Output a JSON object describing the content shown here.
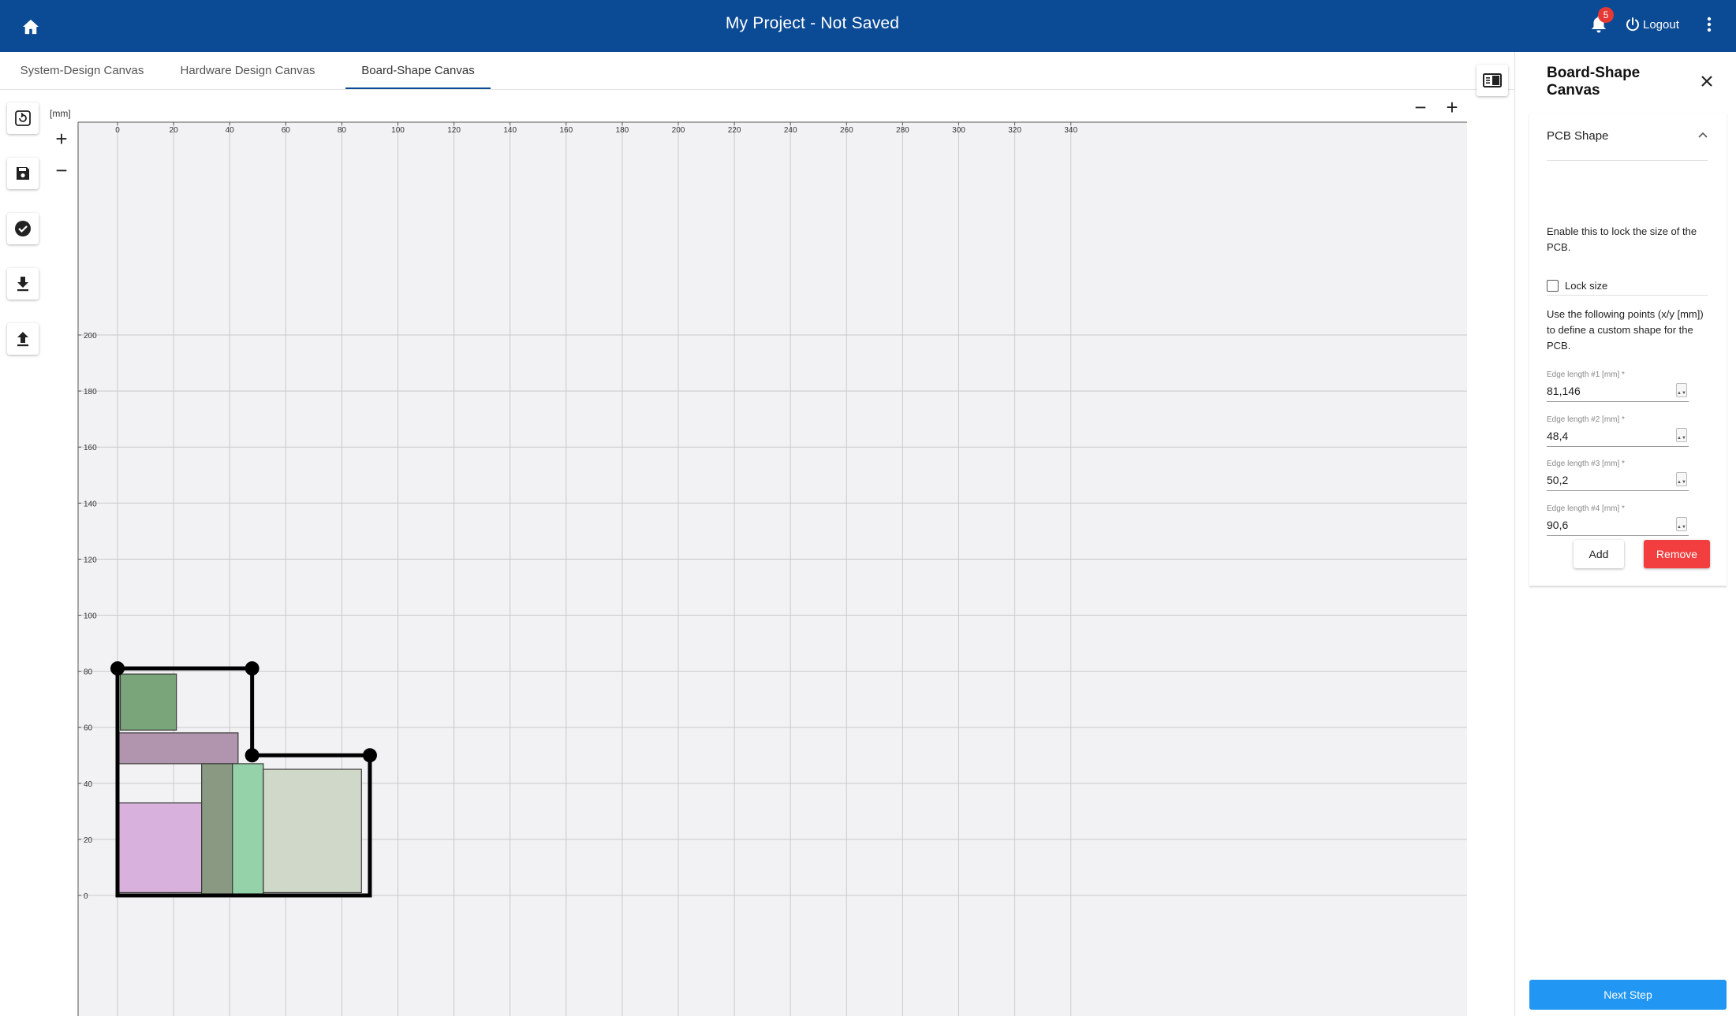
{
  "header": {
    "title": "My Project - Not Saved",
    "notification_count": "5",
    "logout_label": "Logout",
    "colors": {
      "bar": "#0b4a94",
      "badge": "#e53935"
    },
    "icons": {
      "home": "home-icon",
      "bell": "bell-icon",
      "power": "power-icon",
      "menu": "more-vert-icon"
    }
  },
  "tabs": [
    {
      "label": "System-Design Canvas",
      "active": false
    },
    {
      "label": "Hardware Design Canvas",
      "active": false
    },
    {
      "label": "Board-Shape Canvas",
      "active": true
    }
  ],
  "toolbar": {
    "icons": [
      "reset-icon",
      "save-icon",
      "check-circle-icon",
      "download-icon",
      "upload-icon"
    ],
    "zoom_in": "+",
    "zoom_out": "−"
  },
  "canvas": {
    "unit_label": "[mm]",
    "x_ticks": [
      0,
      20,
      40,
      60,
      80,
      100,
      120,
      140,
      160,
      180,
      200,
      220,
      240,
      260,
      280,
      300,
      320,
      340
    ],
    "y_ticks": [
      0,
      20,
      40,
      60,
      80,
      100,
      120,
      140,
      160,
      180,
      200
    ],
    "x_range": [
      0,
      340
    ],
    "y_range": [
      0,
      200
    ],
    "pcb_outline": [
      [
        0,
        81
      ],
      [
        48,
        81
      ],
      [
        48,
        50
      ],
      [
        90,
        50
      ],
      [
        90,
        0
      ],
      [
        0,
        0
      ]
    ],
    "components": [
      {
        "x0": 1,
        "y0": 59,
        "x1": 21,
        "y1": 79,
        "color": "#7aa57a"
      },
      {
        "x0": 0,
        "y0": 47,
        "x1": 43,
        "y1": 58,
        "color": "#b195af"
      },
      {
        "x0": 0,
        "y0": 1,
        "x1": 30,
        "y1": 33,
        "color": "#d8b1dd"
      },
      {
        "x0": 30,
        "y0": 0,
        "x1": 41,
        "y1": 47,
        "color": "#8a9a82"
      },
      {
        "x0": 41,
        "y0": 0,
        "x1": 52,
        "y1": 47,
        "color": "#95d2aa"
      },
      {
        "x0": 52,
        "y0": 1,
        "x1": 87,
        "y1": 45,
        "color": "#d0d8c9"
      }
    ]
  },
  "panel": {
    "title": "Board-Shape Canvas",
    "section": "PCB Shape",
    "lock_desc": "Enable this to lock the size of the PCB.",
    "lock_label": "Lock size",
    "points_desc": "Use the following points (x/y [mm]) to define a custom shape for the PCB.",
    "fields": [
      {
        "label": "Edge length #1 [mm] *",
        "value": "81,146"
      },
      {
        "label": "Edge length #2 [mm] *",
        "value": "48,4"
      },
      {
        "label": "Edge length #3 [mm] *",
        "value": "50,2"
      },
      {
        "label": "Edge length #4 [mm] *",
        "value": "90,6"
      }
    ],
    "add_label": "Add",
    "remove_label": "Remove",
    "next_label": "Next Step"
  }
}
